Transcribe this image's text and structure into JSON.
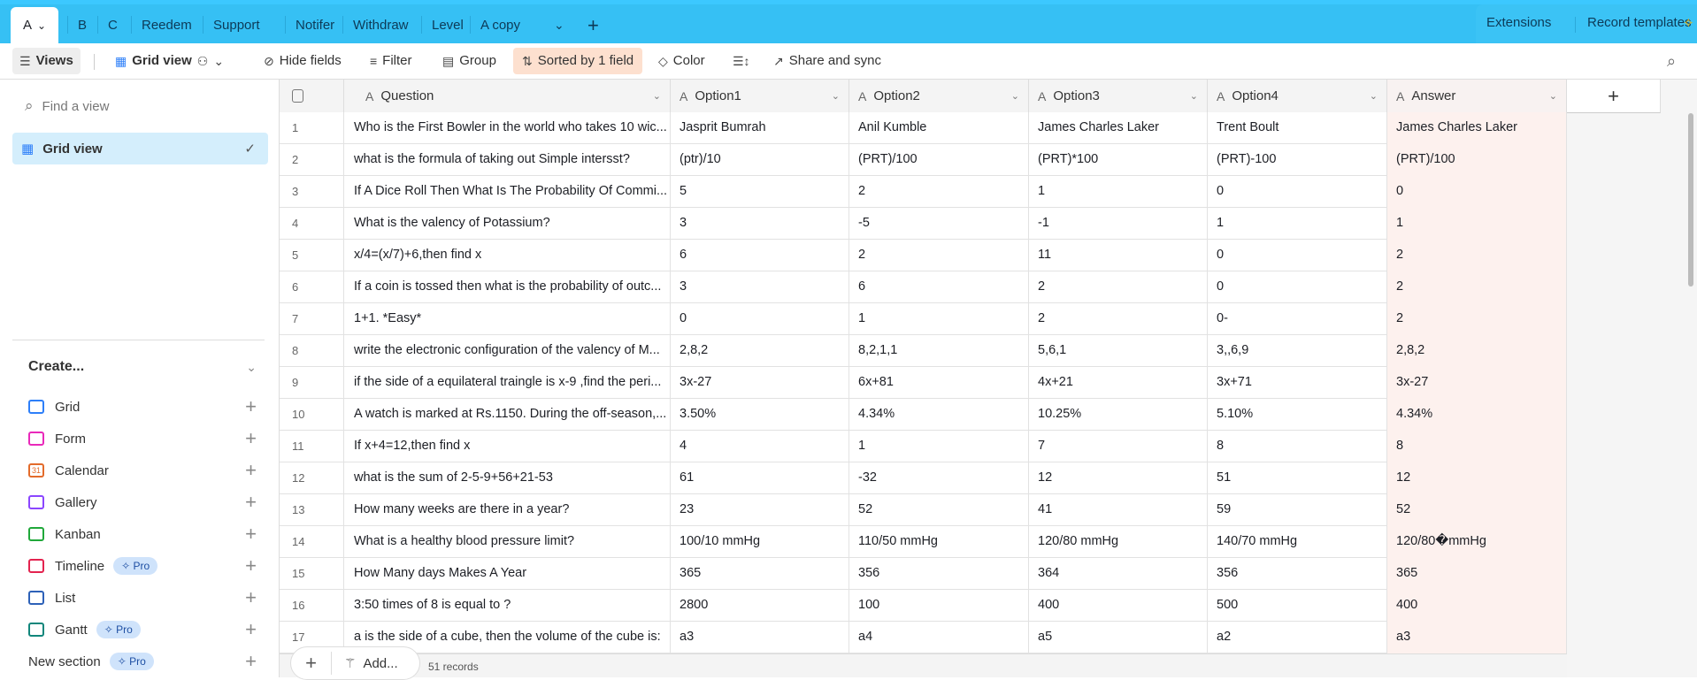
{
  "tabs": [
    "A",
    "B",
    "C",
    "Reedem",
    "Support",
    "Notifer",
    "Withdraw",
    "Level",
    "A copy"
  ],
  "top_right": {
    "extensions": "Extensions",
    "record_templates": "Record templates"
  },
  "toolbar": {
    "views": "Views",
    "grid_view": "Grid view",
    "hide_fields": "Hide fields",
    "filter": "Filter",
    "group": "Group",
    "sorted": "Sorted by 1 field",
    "color": "Color",
    "share": "Share and sync"
  },
  "sidebar": {
    "find_placeholder": "Find a view",
    "selected_view": "Grid view",
    "create": "Create...",
    "items": [
      {
        "label": "Grid",
        "color": "#2d7ff9"
      },
      {
        "label": "Form",
        "color": "#e929ba"
      },
      {
        "label": "Calendar",
        "color": "#e36b2b"
      },
      {
        "label": "Gallery",
        "color": "#8b46ff"
      },
      {
        "label": "Kanban",
        "color": "#20a83a"
      },
      {
        "label": "Timeline",
        "color": "#e3234f",
        "badge": "Pro"
      },
      {
        "label": "List",
        "color": "#2d61b8"
      },
      {
        "label": "Gantt",
        "color": "#11867b",
        "badge": "Pro"
      }
    ],
    "new_section": "New section",
    "pro": "Pro"
  },
  "grid": {
    "columns": [
      "Question",
      "Option1",
      "Option2",
      "Option3",
      "Option4",
      "Answer"
    ],
    "rows": [
      [
        "1",
        "Who is the First Bowler in the world who takes 10 wic...",
        "Jasprit Bumrah",
        "Anil Kumble",
        "James Charles Laker",
        "Trent Boult",
        "James Charles Laker"
      ],
      [
        "2",
        "what is the formula of taking out Simple intersst?",
        "(ptr)/10",
        "(PRT)/100",
        "(PRT)*100",
        "(PRT)-100",
        "(PRT)/100"
      ],
      [
        "3",
        "If A Dice Roll Then What Is The Probability Of Commi...",
        "5",
        "2",
        "1",
        "0",
        "0"
      ],
      [
        "4",
        "What is the valency of Potassium?",
        "3",
        "-5",
        "-1",
        "1",
        "1"
      ],
      [
        "5",
        "x/4=(x/7)+6,then find x",
        "6",
        "2",
        "11",
        "0",
        "2"
      ],
      [
        "6",
        "If a coin is tossed then what is the probability of outc...",
        "3",
        "6",
        "2",
        "0",
        "2"
      ],
      [
        "7",
        "1+1. *Easy*",
        "0",
        "1",
        "2",
        "0-",
        "2"
      ],
      [
        "8",
        "write the electronic configuration of the valency of M...",
        "2,8,2",
        "8,2,1,1",
        "5,6,1",
        "3,,6,9",
        "2,8,2"
      ],
      [
        "9",
        "if the side of a equilateral traingle is x-9 ,find the peri...",
        "3x-27",
        "6x+81",
        "4x+21",
        "3x+71",
        "3x-27"
      ],
      [
        "10",
        "A watch is marked at Rs.1150. During the off-season,...",
        "3.50%",
        "4.34%",
        "10.25%",
        "5.10%",
        "4.34%"
      ],
      [
        "11",
        "If x+4=12,then find x",
        "4",
        "1",
        "7",
        "8",
        "8"
      ],
      [
        "12",
        "what is the sum of 2-5-9+56+21-53",
        "61",
        "-32",
        "12",
        "51",
        "12"
      ],
      [
        "13",
        "How many weeks are there in a year?",
        "23",
        "52",
        "41",
        "59",
        "52"
      ],
      [
        "14",
        "What is a healthy blood pressure limit?",
        "100/10 mmHg",
        "110/50 mmHg",
        "120/80 mmHg",
        "140/70 mmHg",
        "120/80�mmHg"
      ],
      [
        "15",
        "How Many days Makes A Year",
        "365",
        "356",
        "364",
        "356",
        "365"
      ],
      [
        "16",
        "3:50 times of 8 is equal to ?",
        "2800",
        "100",
        "400",
        "500",
        "400"
      ],
      [
        "17",
        "a is the side of a cube, then the volume of the cube is:",
        "a3",
        "a4",
        "a5",
        "a2",
        "a3"
      ]
    ],
    "add_label": "Add...",
    "record_count": "51 records"
  }
}
